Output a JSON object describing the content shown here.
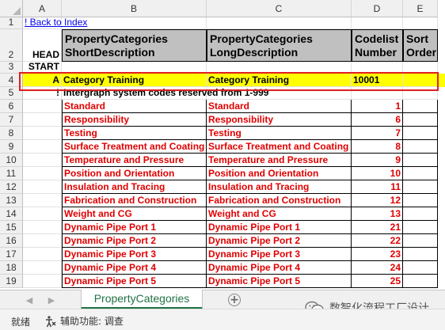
{
  "columns": [
    "A",
    "B",
    "C",
    "D",
    "E"
  ],
  "rows": [
    {
      "num": "1",
      "a": "! Back to Index"
    },
    {
      "num": "2",
      "a": "HEAD",
      "b": "PropertyCategories ShortDescription",
      "c": "PropertyCategories LongDescription",
      "d": "Codelist Number",
      "e": "Sort Order"
    },
    {
      "num": "3",
      "a": "START"
    },
    {
      "num": "4",
      "a": "A",
      "b": "Category Training",
      "c": "Category Training",
      "d": "10001"
    },
    {
      "num": "5",
      "a": "!",
      "b": "Intergraph system codes reserved from 1-999"
    },
    {
      "num": "6",
      "b": "Standard",
      "c": "Standard",
      "d": "1"
    },
    {
      "num": "7",
      "b": "Responsibility",
      "c": "Responsibility",
      "d": "6"
    },
    {
      "num": "8",
      "b": "Testing",
      "c": "Testing",
      "d": "7"
    },
    {
      "num": "9",
      "b": "Surface Treatment and Coating",
      "c": "Surface Treatment and Coating",
      "d": "8"
    },
    {
      "num": "10",
      "b": "Temperature and Pressure",
      "c": "Temperature and Pressure",
      "d": "9"
    },
    {
      "num": "11",
      "b": "Position and Orientation",
      "c": "Position and Orientation",
      "d": "10"
    },
    {
      "num": "12",
      "b": "Insulation and Tracing",
      "c": "Insulation and Tracing",
      "d": "11"
    },
    {
      "num": "13",
      "b": "Fabrication and Construction",
      "c": "Fabrication and Construction",
      "d": "12"
    },
    {
      "num": "14",
      "b": "Weight and CG",
      "c": "Weight and CG",
      "d": "13"
    },
    {
      "num": "15",
      "b": "Dynamic Pipe Port 1",
      "c": "Dynamic Pipe Port 1",
      "d": "21"
    },
    {
      "num": "16",
      "b": "Dynamic Pipe Port 2",
      "c": "Dynamic Pipe Port 2",
      "d": "22"
    },
    {
      "num": "17",
      "b": "Dynamic Pipe Port 3",
      "c": "Dynamic Pipe Port 3",
      "d": "23"
    },
    {
      "num": "18",
      "b": "Dynamic Pipe Port 4",
      "c": "Dynamic Pipe Port 4",
      "d": "24"
    },
    {
      "num": "19",
      "b": "Dynamic Pipe Port 5",
      "c": "Dynamic Pipe Port 5",
      "d": "25"
    }
  ],
  "sheet_tab": "PropertyCategories",
  "status": {
    "ready": "就绪",
    "accessibility": "辅助功能: 调查"
  },
  "watermark": "数智化流程工厂设计",
  "colors": {
    "highlight_row": "#ffff00",
    "header_fill": "#c0c0c0",
    "code_text": "#e00000",
    "selection_border": "#e02020",
    "tab_accent": "#217346"
  },
  "icons": [
    "scroll-left-icon",
    "scroll-right-icon",
    "add-sheet-icon",
    "accessibility-icon",
    "wechat-icon"
  ]
}
